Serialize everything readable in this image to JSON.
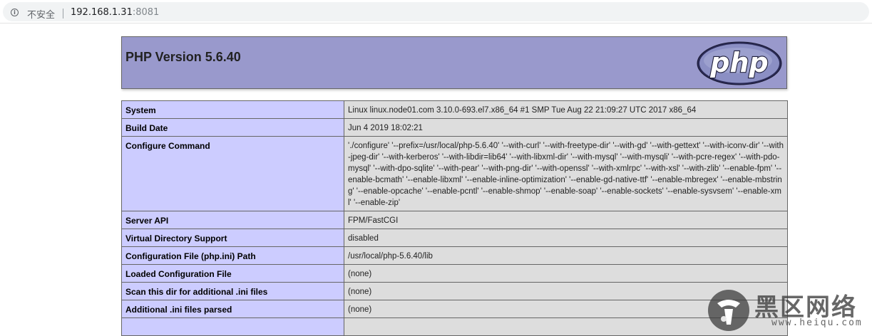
{
  "browser": {
    "security_label": "不安全",
    "url_host": "192.168.1.31",
    "url_port": ":8081"
  },
  "header": {
    "title": "PHP Version 5.6.40",
    "logo_text": "php"
  },
  "rows": [
    {
      "key": "System",
      "value": "Linux linux.node01.com 3.10.0-693.el7.x86_64 #1 SMP Tue Aug 22 21:09:27 UTC 2017 x86_64"
    },
    {
      "key": "Build Date",
      "value": "Jun 4 2019 18:02:21"
    },
    {
      "key": "Configure Command",
      "value": "'./configure' '--prefix=/usr/local/php-5.6.40' '--with-curl' '--with-freetype-dir' '--with-gd' '--with-gettext' '--with-iconv-dir' '--with-jpeg-dir' '--with-kerberos' '--with-libdir=lib64' '--with-libxml-dir' '--with-mysql' '--with-mysqli' '--with-pcre-regex' '--with-pdo-mysql' '--with-dpo-sqlite' '--with-pear' '--with-png-dir' '--with-openssl' '--with-xmlrpc' '--with-xsl' '--with-zlib' '--enable-fpm' '--enable-bcmath' '--enable-libxml' '--enable-inline-optimization' '--enable-gd-native-ttf' '--enable-mbregex' '--enable-mbstring' '--enable-opcache' '--enable-pcntl' '--enable-shmop' '--enable-soap' '--enable-sockets' '--enable-sysvsem' '--enable-xml' '--enable-zip'"
    },
    {
      "key": "Server API",
      "value": "FPM/FastCGI"
    },
    {
      "key": "Virtual Directory Support",
      "value": "disabled"
    },
    {
      "key": "Configuration File (php.ini) Path",
      "value": "/usr/local/php-5.6.40/lib"
    },
    {
      "key": "Loaded Configuration File",
      "value": "(none)"
    },
    {
      "key": "Scan this dir for additional .ini files",
      "value": "(none)"
    },
    {
      "key": "Additional .ini files parsed",
      "value": "(none)"
    },
    {
      "key": "",
      "value": ""
    }
  ],
  "watermark": {
    "text": "黑区网络",
    "url": "www.heiqu.com"
  }
}
